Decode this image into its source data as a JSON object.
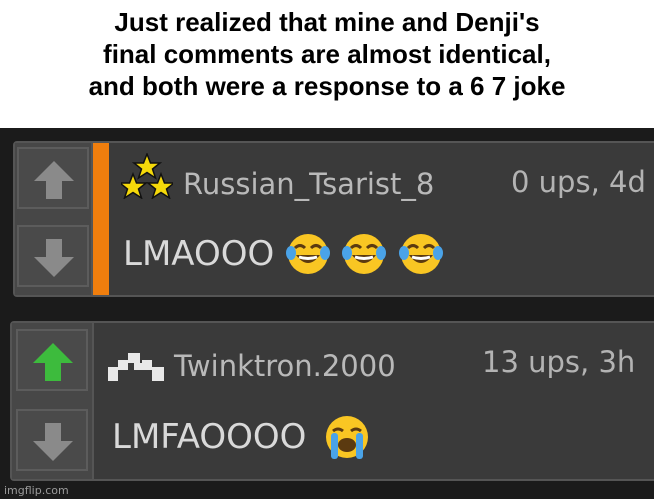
{
  "caption": {
    "line1": "Just realized that mine and Denji's",
    "line2": "final comments are almost identical,",
    "line3": "and both were a response to a 6 7 joke"
  },
  "comments": [
    {
      "username": "Russian_Tsarist_8",
      "meta": "0 ups, 4d",
      "text": "LMAOOO",
      "emoji": [
        "face-with-tears-of-joy",
        "face-with-tears-of-joy",
        "face-with-tears-of-joy"
      ],
      "upvote_active": false,
      "accent_color": "#f07e0d",
      "avatar": "three-stars-icon"
    },
    {
      "username": "Twinktron.2000",
      "meta": "13 ups, 3h",
      "text": "LMFAOOOO",
      "emoji": [
        "loudly-crying-face"
      ],
      "upvote_active": true,
      "upvote_color": "#3dbb3d",
      "avatar": "pixel-blocks-icon"
    }
  ],
  "watermark": "imgflip.com"
}
